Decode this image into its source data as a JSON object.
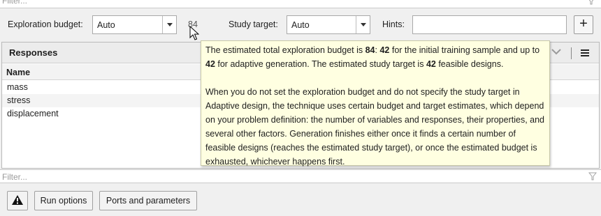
{
  "top_filter": {
    "placeholder": "Filter..."
  },
  "toolbar": {
    "exploration_budget_label": "Exploration budget:",
    "exploration_budget_value": "Auto",
    "budget_number": "84",
    "study_target_label": "Study target:",
    "study_target_value": "Auto",
    "hints_label": "Hints:",
    "hints_value": "",
    "add_label": "+"
  },
  "responses": {
    "title": "Responses",
    "column_name": "Name",
    "rows": [
      "mass",
      "stress",
      "displacement"
    ]
  },
  "bottom_filter": {
    "placeholder": "Filter..."
  },
  "bottom_bar": {
    "run_options_label": "Run options",
    "ports_label": "Ports and parameters"
  },
  "tooltip": {
    "p1_a": "The estimated total exploration budget is ",
    "p1_b": "84",
    "p1_c": ": ",
    "p1_d": "42",
    "p1_e": " for the initial training sample and up to ",
    "p1_f": "42",
    "p1_g": " for adaptive generation. The estimated study target is ",
    "p1_h": "42",
    "p1_i": " feasible designs.",
    "p2": "When you do not set the exploration budget and do not specify the study target in Adaptive design, the technique uses certain budget and target estimates, which depend on your problem definition: the number of variables and responses, their properties, and several other factors. Generation finishes either once it finds a certain number of feasible designs (reaches the estimated study target), or once the estimated budget is exhausted, whichever happens first."
  },
  "icons": {
    "filter": "filter-icon",
    "dropdown": "chevron-down-icon",
    "menu": "menu-icon",
    "warning": "warning-icon",
    "cursor": "mouse-pointer-icon"
  }
}
